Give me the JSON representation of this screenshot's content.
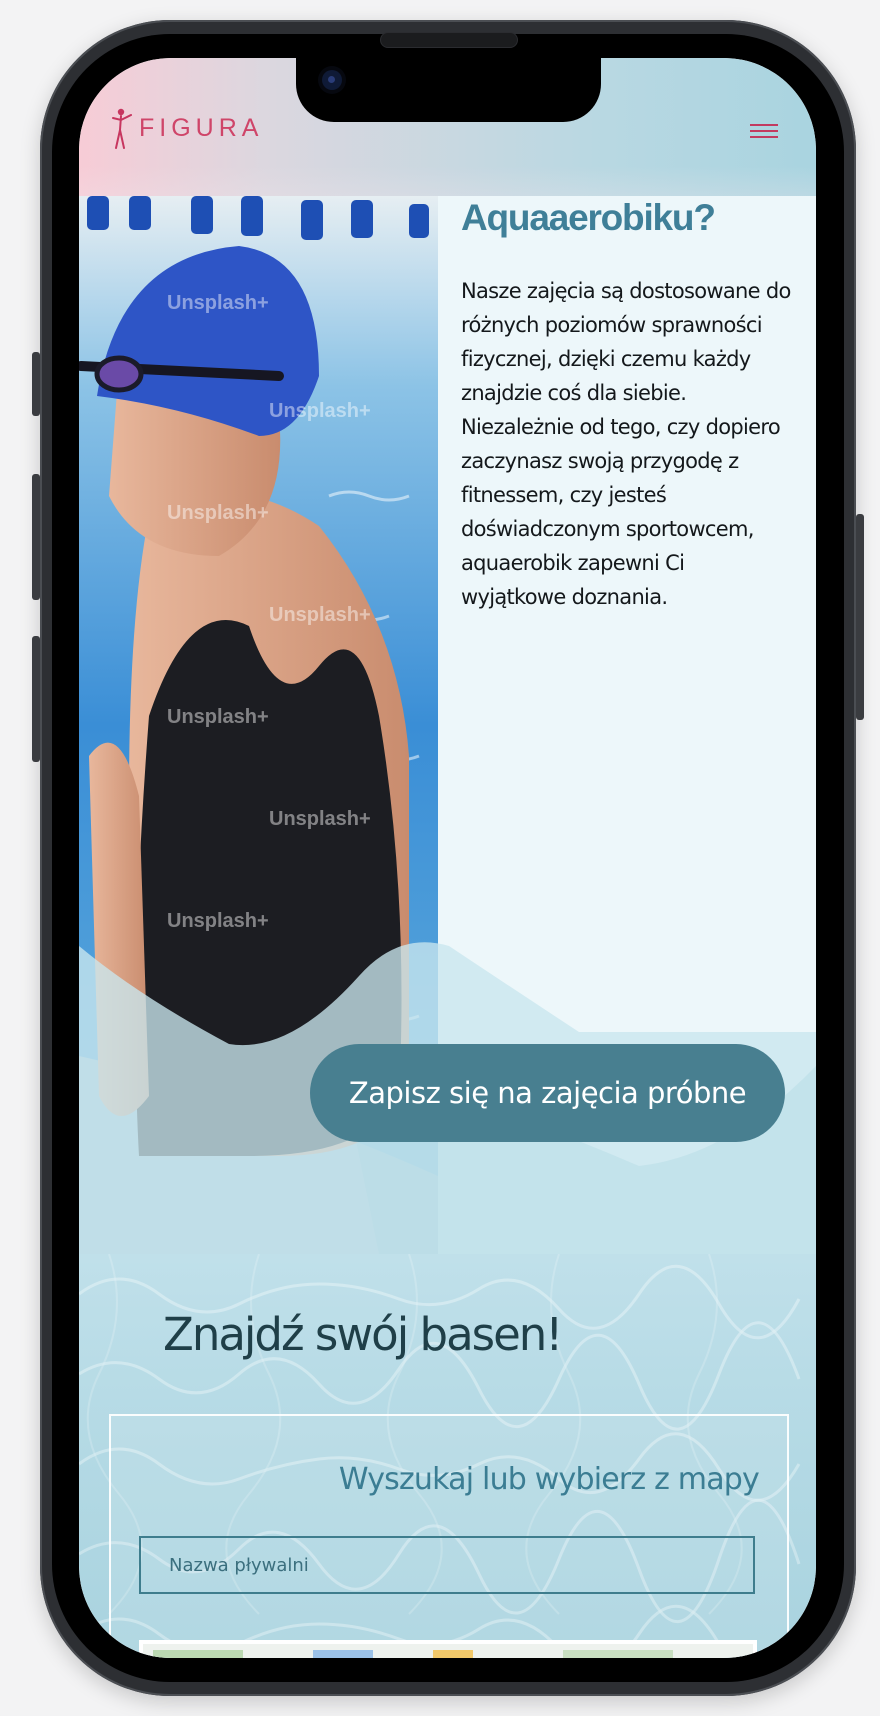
{
  "header": {
    "logo_text": "FIGURA",
    "brand_color": "#c7365f",
    "menu_icon": "hamburger-icon"
  },
  "aqua_section": {
    "heading": "Aquaaerobiku?",
    "body": "Nasze zajęcia są dostosowane do różnych poziomów sprawności fizycznej, dzięki czemu każdy znajdzie coś dla siebie. Niezależnie od tego, czy dopiero zaczynasz swoją przygodę z fitnessem, czy jesteś doświadczonym sportowcem, aquaerobik zapewni Ci wyjątkowe doznania.",
    "watermark": "Unsplash+",
    "cta_label": "Zapisz się na zajęcia próbne",
    "accent_color": "#487f90",
    "heading_color": "#3f7f98"
  },
  "pool_section": {
    "title": "Znajdź swój basen!",
    "subtitle": "Wyszukaj lub wybierz z mapy",
    "search": {
      "placeholder": "Nazwa pływalni"
    }
  }
}
